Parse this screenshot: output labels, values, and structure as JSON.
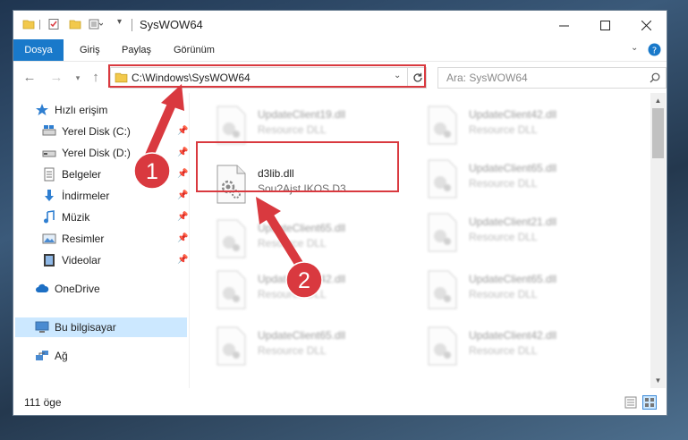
{
  "window": {
    "title": "SysWOW64",
    "controls": {
      "minimize": "minimize-icon",
      "maximize": "maximize-icon",
      "close": "close-icon"
    }
  },
  "ribbon": {
    "tabs": [
      "Dosya",
      "Giriş",
      "Paylaş",
      "Görünüm"
    ],
    "accent": "#1979ca"
  },
  "address": {
    "path": "C:\\Windows\\SysWOW64",
    "search_placeholder": "Ara: SysWOW64"
  },
  "sidebar": {
    "quick_access": "Hızlı erişim",
    "items": [
      {
        "label": "Yerel Disk (C:)",
        "icon": "drive-icon",
        "pinned": true
      },
      {
        "label": "Yerel Disk (D:)",
        "icon": "drive-icon",
        "pinned": true
      },
      {
        "label": "Belgeler",
        "icon": "documents-icon",
        "pinned": true
      },
      {
        "label": "İndirmeler",
        "icon": "download-icon",
        "pinned": true
      },
      {
        "label": "Müzik",
        "icon": "music-icon",
        "pinned": true
      },
      {
        "label": "Resimler",
        "icon": "pictures-icon",
        "pinned": true
      },
      {
        "label": "Videolar",
        "icon": "videos-icon",
        "pinned": true
      }
    ],
    "onedrive": "OneDrive",
    "this_pc": "Bu bilgisayar",
    "network": "Ağ"
  },
  "files": {
    "left_column": [
      {
        "name": "UpdateClient19.dll",
        "desc": "Resource DLL"
      },
      {
        "name": "d3lib.dll",
        "desc": "Sou?Ajst IKOS D3",
        "highlight": true
      },
      {
        "name": "UpdateClient65.dll",
        "desc": "Resource DLL"
      },
      {
        "name": "UpdateClient42.dll",
        "desc": "Resource DLL"
      },
      {
        "name": "UpdateClient65.dll",
        "desc": "Resource DLL"
      }
    ],
    "right_column": [
      {
        "name": "UpdateClient42.dll",
        "desc": "Resource DLL"
      },
      {
        "name": "UpdateClient65.dll",
        "desc": "Resource DLL"
      },
      {
        "name": "UpdateClient21.dll",
        "desc": "Resource DLL"
      },
      {
        "name": "UpdateClient65.dll",
        "desc": "Resource DLL"
      },
      {
        "name": "UpdateClient42.dll",
        "desc": "Resource DLL"
      }
    ]
  },
  "status": {
    "count": "111 öge"
  },
  "annotations": {
    "step1": "1",
    "step2": "2",
    "color": "#d9393f"
  }
}
